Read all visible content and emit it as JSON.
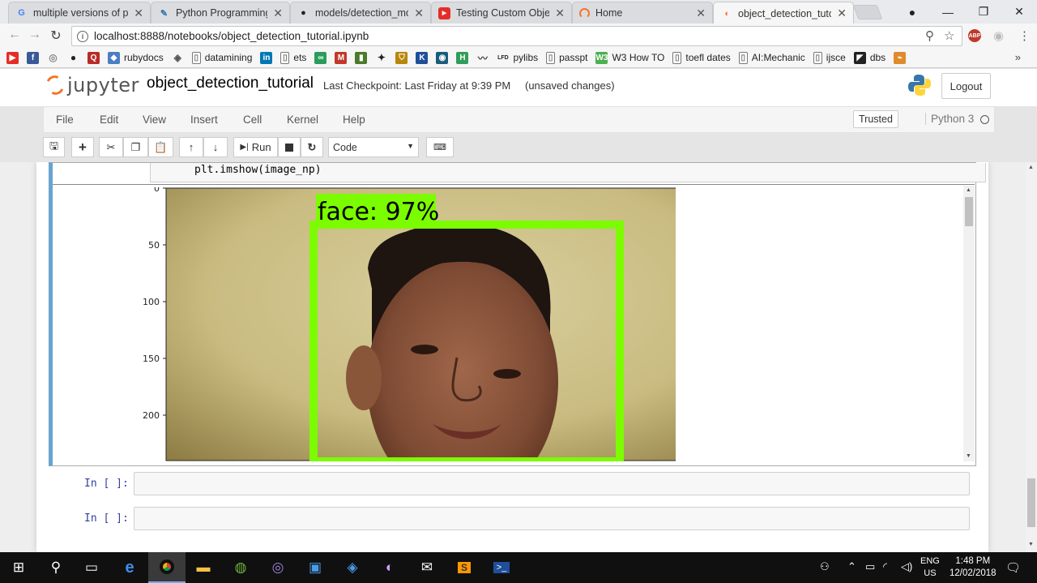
{
  "browser": {
    "tabs": [
      {
        "title": "multiple versions of pro",
        "favicon": "google-icon"
      },
      {
        "title": "Python Programming T",
        "favicon": "python-icon"
      },
      {
        "title": "models/detection_mod",
        "favicon": "github-icon"
      },
      {
        "title": "Testing Custom Object",
        "favicon": "youtube-icon"
      },
      {
        "title": "Home",
        "favicon": "jupyter-loading-icon"
      },
      {
        "title": "object_detection_tutori",
        "favicon": "jupyter-icon",
        "active": true
      }
    ],
    "url": "localhost:8888/notebooks/object_detection_tutorial.ipynb",
    "bookmarks": [
      {
        "label": "",
        "icon": "youtube-icon",
        "color": "#e52d27"
      },
      {
        "label": "",
        "icon": "facebook-icon",
        "color": "#3b5998"
      },
      {
        "label": "",
        "icon": "globe-icon",
        "color": "#888888"
      },
      {
        "label": "",
        "icon": "github-icon",
        "color": "#222222"
      },
      {
        "label": "",
        "icon": "quora-icon",
        "color": "#b92b27"
      },
      {
        "label": "rubydocs",
        "icon": "ruby-icon",
        "color": "#4a7fc1"
      },
      {
        "label": "",
        "icon": "diamond-icon",
        "color": "#555555"
      },
      {
        "label": "datamining",
        "icon": "page-icon",
        "color": "#ffffff"
      },
      {
        "label": "",
        "icon": "linkedin-icon",
        "color": "#0077b5"
      },
      {
        "label": "ets",
        "icon": "page-icon",
        "color": "#ffffff"
      },
      {
        "label": "",
        "icon": "link-icon",
        "color": "#2a9d5c"
      },
      {
        "label": "",
        "icon": "mcgraw-icon",
        "color": "#c0392b"
      },
      {
        "label": "",
        "icon": "chart-icon",
        "color": "#4a7a2a"
      },
      {
        "label": "",
        "icon": "star-icon",
        "color": "#222222"
      },
      {
        "label": "",
        "icon": "shield-icon",
        "color": "#b8860b"
      },
      {
        "label": "",
        "icon": "k-icon",
        "color": "#1f4e9a"
      },
      {
        "label": "",
        "icon": "circle-icon",
        "color": "#1a5c7a"
      },
      {
        "label": "",
        "icon": "h-icon",
        "color": "#2e9e5a"
      },
      {
        "label": "",
        "icon": "wave-icon",
        "color": "#444444"
      },
      {
        "label": "pylibs",
        "icon": "lfd-icon",
        "color": "#222222"
      },
      {
        "label": "passpt",
        "icon": "page-icon",
        "color": "#ffffff"
      },
      {
        "label": "W3 How TO",
        "icon": "w3-icon",
        "color": "#4caf50"
      },
      {
        "label": "toefl dates",
        "icon": "page-icon",
        "color": "#ffffff"
      },
      {
        "label": "AI:Mechanic",
        "icon": "page-icon",
        "color": "#ffffff"
      },
      {
        "label": "ijsce",
        "icon": "page-icon",
        "color": "#ffffff"
      },
      {
        "label": "dbs",
        "icon": "dbs-icon",
        "color": "#222222"
      },
      {
        "label": "",
        "icon": "bird-icon",
        "color": "#e08a2c"
      }
    ]
  },
  "jupyter": {
    "logo_text": "jupyter",
    "notebook_name": "object_detection_tutorial",
    "checkpoint": "Last Checkpoint: Last Friday at 9:39 PM",
    "unsaved": "(unsaved changes)",
    "logout": "Logout",
    "menu": [
      "File",
      "Edit",
      "View",
      "Insert",
      "Cell",
      "Kernel",
      "Help"
    ],
    "trusted": "Trusted",
    "kernel": "Python 3",
    "toolbar": {
      "run": "Run",
      "cell_type": "Code"
    },
    "code_line": "plt.imshow(image_np)",
    "output": {
      "detection_label": "face: 97%",
      "box_color": "#7cfc00",
      "yticks": [
        "0",
        "50",
        "100",
        "150",
        "200"
      ]
    },
    "empty_prompt": "In [ ]:"
  },
  "taskbar": {
    "lang": "ENG",
    "region": "US",
    "time": "1:48 PM",
    "date": "12/02/2018"
  }
}
